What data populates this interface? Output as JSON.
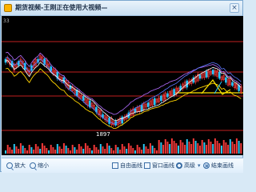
{
  "window": {
    "title": "期货视频-王刚正在使用大视频—",
    "close_label": "×"
  },
  "chart": {
    "code_label": "33",
    "low_label": "1897",
    "colors": {
      "background": "#000000",
      "candle_up": "#ff3b3b",
      "candle_down": "#23c7ff",
      "ma_white": "#ffffff",
      "ma_yellow": "#ffd400",
      "ma_purple": "#b26cff",
      "ma_blue": "#5d78ff",
      "hline_red": "#ff2b2b",
      "hline_yellow": "#ffe500",
      "volume_up": "#ff3b3b",
      "volume_down": "#2ad3ff"
    }
  },
  "toolbar": {
    "zoom_in_label": "放大",
    "zoom_out_label": "缩小",
    "auto_draw_label": "自由画线",
    "window_draw_label": "窗口画线",
    "advanced_label": "高级",
    "end_draw_label": "结束画线"
  }
}
